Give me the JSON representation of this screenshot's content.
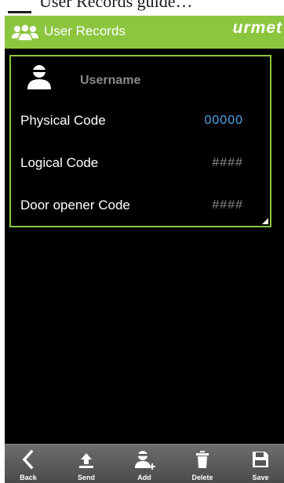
{
  "cropped_top": {
    "text": "User Records guide…"
  },
  "header": {
    "title": "User Records",
    "brand": "urmet",
    "icon": "users-group-icon"
  },
  "record": {
    "username": "Username",
    "fields": [
      {
        "label": "Physical Code",
        "value": "00000"
      },
      {
        "label": "Logical Code",
        "value": "####"
      },
      {
        "label": "Door opener Code",
        "value": "####"
      }
    ]
  },
  "toolbar": {
    "items": [
      {
        "label": "Back",
        "icon": "chevron-left-icon"
      },
      {
        "label": "Send",
        "icon": "upload-icon"
      },
      {
        "label": "Add",
        "icon": "add-user-icon"
      },
      {
        "label": "Delete",
        "icon": "trash-icon"
      },
      {
        "label": "Save",
        "icon": "floppy-disk-icon"
      }
    ]
  },
  "colors": {
    "accent": "#8cc63f",
    "value_highlight": "#4fa3ea",
    "background": "#000000"
  }
}
